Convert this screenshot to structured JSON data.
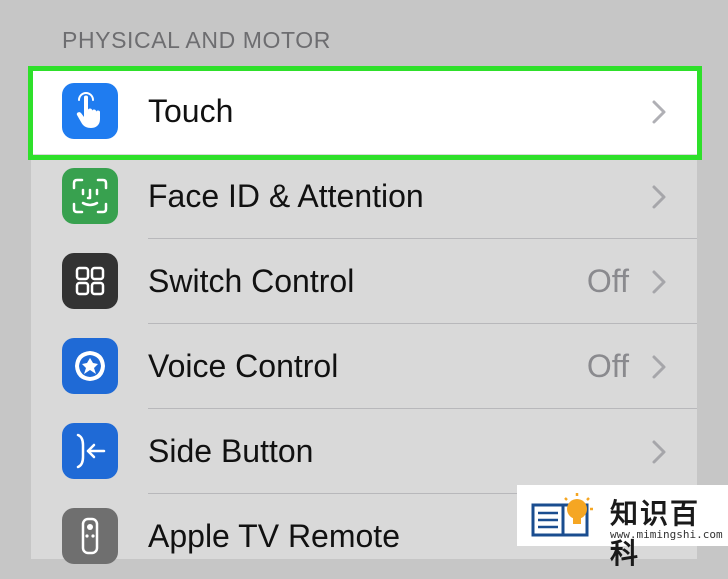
{
  "section": {
    "header": "PHYSICAL AND MOTOR"
  },
  "rows": [
    {
      "label": "Touch",
      "value": "",
      "icon": "hand-touch-icon",
      "icon_color": "#1f7cf0",
      "highlighted": true
    },
    {
      "label": "Face ID & Attention",
      "value": "",
      "icon": "face-id-icon",
      "icon_color": "#38a14f"
    },
    {
      "label": "Switch Control",
      "value": "Off",
      "icon": "switch-control-icon",
      "icon_color": "#333333"
    },
    {
      "label": "Voice Control",
      "value": "Off",
      "icon": "voice-control-icon",
      "icon_color": "#1f6ad6"
    },
    {
      "label": "Side Button",
      "value": "",
      "icon": "side-button-icon",
      "icon_color": "#1f6ad6"
    },
    {
      "label": "Apple TV Remote",
      "value": "",
      "icon": "apple-tv-remote-icon",
      "icon_color": "#6f6f6f"
    }
  ],
  "colors": {
    "highlight": "#2ee02a",
    "background": "#c6c6c6",
    "group_background": "#d9d9d9",
    "selected_row_background": "#ffffff"
  },
  "watermark": {
    "title": "知识百科",
    "url": "www.mimingshi.com"
  }
}
